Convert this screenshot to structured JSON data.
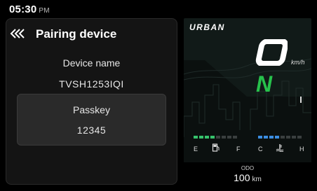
{
  "status": {
    "time": "05:30",
    "ampm": "PM"
  },
  "pairing": {
    "title": "Pairing device",
    "device_name_label": "Device name",
    "device_name_value": "TVSH1253IQI",
    "passkey_label": "Passkey",
    "passkey_value": "12345"
  },
  "cluster": {
    "mode": "URBAN",
    "speed": "0",
    "speed_unit": "km/h",
    "gear": "N",
    "fuel_gauge": {
      "label_empty": "E",
      "label_full": "F",
      "level": 0.5
    },
    "temp_gauge": {
      "label_cold": "C",
      "label_hot": "H",
      "level": 0.5
    },
    "odo_label": "ODO",
    "odo_value": "100",
    "odo_unit": "km"
  },
  "colors": {
    "gear": "#27c24c",
    "fuel_bar": "#36c26b",
    "temp_bar": "#3b8de0"
  },
  "icons": [
    "back-chevrons-icon",
    "fuel-pump-icon",
    "coolant-temperature-icon"
  ]
}
